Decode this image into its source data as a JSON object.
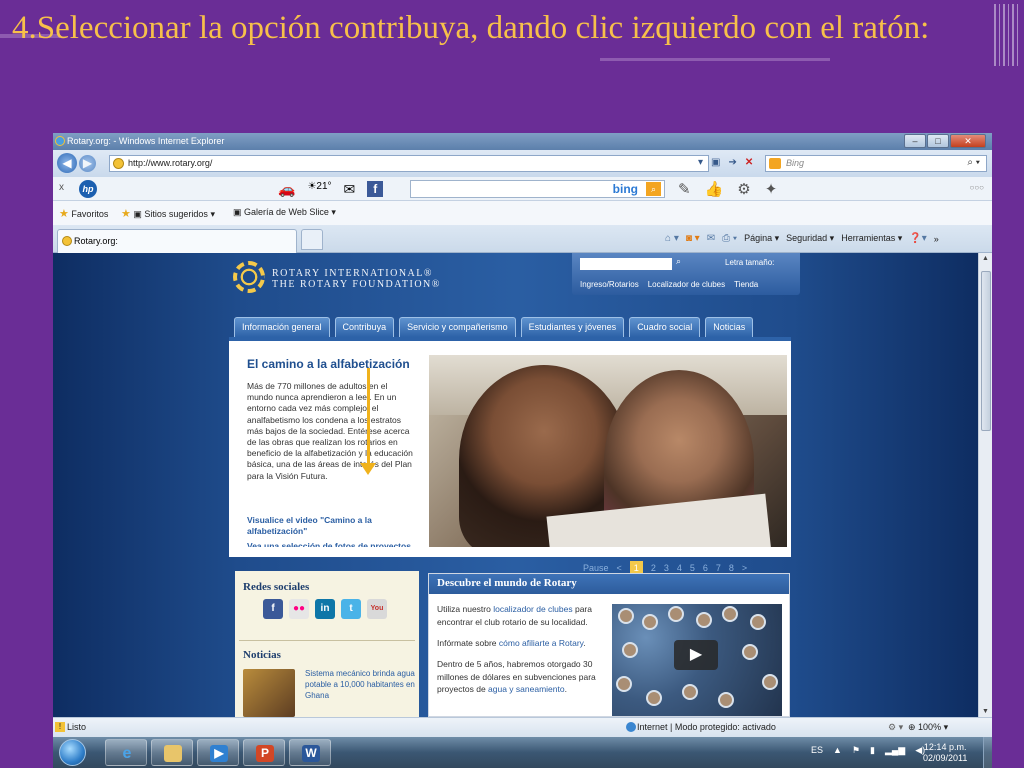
{
  "slide": {
    "title": "4.Seleccionar la opción contribuya, dando clic izquierdo con el ratón:"
  },
  "browser": {
    "window_title": "Rotary.org: - Windows Internet Explorer",
    "address": "http://www.rotary.org/",
    "search_engine_placeholder": "Bing",
    "hp_search_brand": "bing",
    "hp_temp": "21°",
    "close_x": "x",
    "hp_logo": "hp",
    "favorites": "Favoritos",
    "suggested_sites": "Sitios sugeridos",
    "web_slice": "Galería de Web Slice",
    "tab_label": "Rotary.org:",
    "commands": {
      "page": "Página",
      "security": "Seguridad",
      "tools": "Herramientas"
    },
    "status": "Listo",
    "zone": "Internet | Modo protegido: activado",
    "zoom": "100%"
  },
  "site": {
    "logo_line1": "ROTARY INTERNATIONAL®",
    "logo_line2": "THE ROTARY FOUNDATION®",
    "text_size": "Letra tamaño:",
    "top_links": [
      "Ingreso/Rotarios",
      "Localizador de clubes",
      "Tienda"
    ],
    "nav": [
      "Información general",
      "Contribuya",
      "Servicio y compañerismo",
      "Estudiantes y jóvenes",
      "Cuadro social",
      "Noticias"
    ],
    "feature": {
      "title": "El camino a la alfabetización",
      "body": "Más de 770 millones de adultos en el mundo nunca aprendieron a leer. En un entorno cada vez más complejo, el analfabetismo los condena a los estratos más bajos de la sociedad. Entérese acerca de las obras que realizan los rotarios en beneficio de la alfabetización y la educación básica, una de las áreas de interés del Plan para la Visión Futura.",
      "link1": "Visualice el video \"Camino a la alfabetización\"",
      "link2": "Vea una selección de fotos de proyectos"
    },
    "pager": {
      "pause": "Pause",
      "prev": "<",
      "pages": [
        "1",
        "2",
        "3",
        "4",
        "5",
        "6",
        "7",
        "8"
      ],
      "next": ">"
    },
    "social": {
      "title": "Redes sociales",
      "icons": [
        "facebook-icon",
        "flickr-icon",
        "linkedin-icon",
        "twitter-icon",
        "youtube-icon"
      ]
    },
    "news": {
      "title": "Noticias",
      "item": "Sistema mecánico brinda agua potable a 10,000 habitantes en Ghana"
    },
    "discover": {
      "title": "Descubre el mundo de Rotary",
      "p1_pre": "Utiliza nuestro ",
      "p1_link": "localizador de clubes",
      "p1_post": " para encontrar el club rotario de su localidad.",
      "p2_pre": "Infórmate sobre ",
      "p2_link": "cómo afiliarte a Rotary",
      "p2_post": ".",
      "p3_pre": "Dentro de 5 años, habremos otorgado 30 millones de dólares en subvenciones para proyectos de ",
      "p3_link": "agua y saneamiento",
      "p3_post": "."
    }
  },
  "taskbar": {
    "lang": "ES",
    "time": "12:14 p.m.",
    "date": "02/09/2011"
  },
  "colors": {
    "slide_bg": "#6a2d96",
    "title": "#f7c04a",
    "arrow": "#f0b21c",
    "rotary_blue": "#2d62a8"
  }
}
